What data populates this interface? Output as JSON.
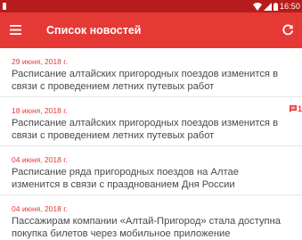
{
  "status_bar": {
    "time": "16:50",
    "icons": [
      "sim-icon",
      "wifi-icon",
      "signal-icon",
      "battery-icon"
    ]
  },
  "app_bar": {
    "title": "Список новостей",
    "menu_icon": "menu-icon",
    "refresh_icon": "refresh-icon",
    "color": "#e53935"
  },
  "colors": {
    "accent": "#e53935",
    "status_bar": "#b71c1c",
    "text": "#4a4a4a"
  },
  "news": [
    {
      "date": "29 июня, 2018 г.",
      "title_lines": [
        "Расписание алтайских пригородных поездов изменится в",
        "связи с проведением летних путевых работ"
      ]
    },
    {
      "date": "18 июня, 2018 г.",
      "title_lines": [
        "Расписание алтайских пригородных поездов изменится в",
        "связи с проведением летних путевых работ"
      ],
      "badge": {
        "icon": "comment-icon",
        "count": "1"
      }
    },
    {
      "date": "04 июня, 2018 г.",
      "title_lines": [
        "Расписание ряда пригородных поездов на Алтае",
        "изменится в связи с празднованием Дня России"
      ]
    },
    {
      "date": "04 июня, 2018 г.",
      "title_lines": [
        "Пассажирам компании «Алтай-Пригород» стала доступна",
        "покупка билетов через мобильное приложение"
      ]
    }
  ]
}
